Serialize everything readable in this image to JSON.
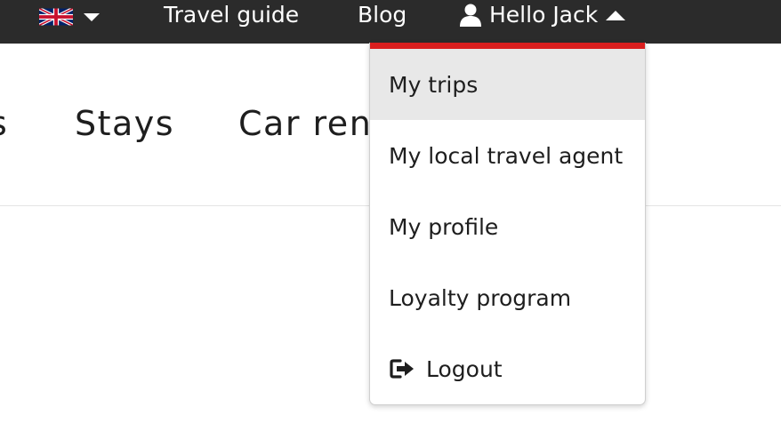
{
  "topbar": {
    "language": {
      "flag_icon": "uk-flag-icon",
      "caret_icon": "caret-down-icon"
    },
    "links": [
      {
        "label": "Travel guide"
      },
      {
        "label": "Blog"
      }
    ],
    "account": {
      "user_icon": "user-icon",
      "label": "Hello Jack",
      "caret_icon": "caret-up-icon"
    },
    "background": "#2b2b2b"
  },
  "subnav": {
    "items": [
      {
        "label": "s"
      },
      {
        "label": "Stays"
      },
      {
        "label": "Car rentals"
      }
    ]
  },
  "account_menu": {
    "accent_color": "#d91e1e",
    "items": [
      {
        "label": "My trips",
        "active": true
      },
      {
        "label": "My local travel agent"
      },
      {
        "label": "My profile"
      },
      {
        "label": "Loyalty program"
      },
      {
        "label": "Logout",
        "icon": "logout-icon"
      }
    ]
  }
}
